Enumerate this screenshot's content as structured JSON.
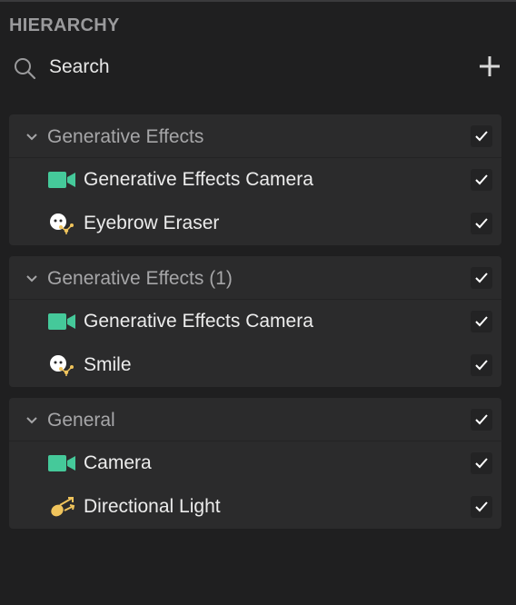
{
  "panel": {
    "title": "HIERARCHY"
  },
  "search": {
    "label": "Search"
  },
  "colors": {
    "camera": "#45c99a",
    "accent_yellow": "#f0c45c",
    "background": "#1f1f20",
    "group_bg": "#2b2b2c"
  },
  "groups": [
    {
      "label": "Generative Effects",
      "checked": true,
      "items": [
        {
          "label": "Generative Effects Camera",
          "icon": "camera-icon",
          "checked": true
        },
        {
          "label": "Eyebrow Eraser",
          "icon": "face-effect-icon",
          "checked": true
        }
      ]
    },
    {
      "label": "Generative Effects (1)",
      "checked": true,
      "items": [
        {
          "label": "Generative Effects Camera",
          "icon": "camera-icon",
          "checked": true
        },
        {
          "label": "Smile",
          "icon": "face-effect-icon",
          "checked": true
        }
      ]
    },
    {
      "label": "General",
      "checked": true,
      "items": [
        {
          "label": "Camera",
          "icon": "camera-icon",
          "checked": true
        },
        {
          "label": "Directional Light",
          "icon": "directional-light-icon",
          "checked": true
        }
      ]
    }
  ]
}
